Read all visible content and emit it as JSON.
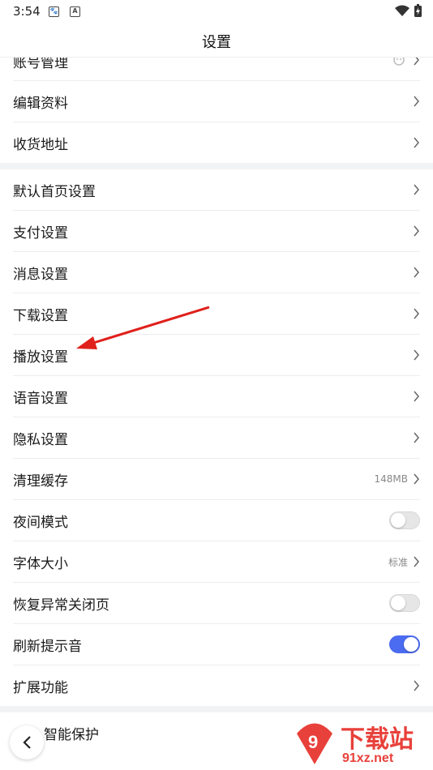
{
  "status": {
    "time": "3:54",
    "icon_a": "A"
  },
  "header": {
    "title": "设置"
  },
  "group1": [
    {
      "label": "账号管理"
    },
    {
      "label": "编辑资料"
    },
    {
      "label": "收货地址"
    }
  ],
  "group2": [
    {
      "label": "默认首页设置"
    },
    {
      "label": "支付设置"
    },
    {
      "label": "消息设置"
    },
    {
      "label": "下载设置"
    },
    {
      "label": "播放设置"
    },
    {
      "label": "语音设置"
    },
    {
      "label": "隐私设置"
    },
    {
      "label": "清理缓存",
      "value": "148MB"
    },
    {
      "label": "夜间模式",
      "toggle": false
    },
    {
      "label": "字体大小",
      "value": "标准"
    },
    {
      "label": "恢复异常关闭页",
      "toggle": false
    },
    {
      "label": "刷新提示音",
      "toggle": true
    },
    {
      "label": "扩展功能"
    }
  ],
  "group3": [
    {
      "label": "智能保护"
    }
  ],
  "watermark": {
    "text": "下载站",
    "url": "91xz.net"
  },
  "colors": {
    "toggle_on": "#4b6bf0",
    "annotation_arrow": "#e0201b",
    "watermark": "#e8403a"
  }
}
